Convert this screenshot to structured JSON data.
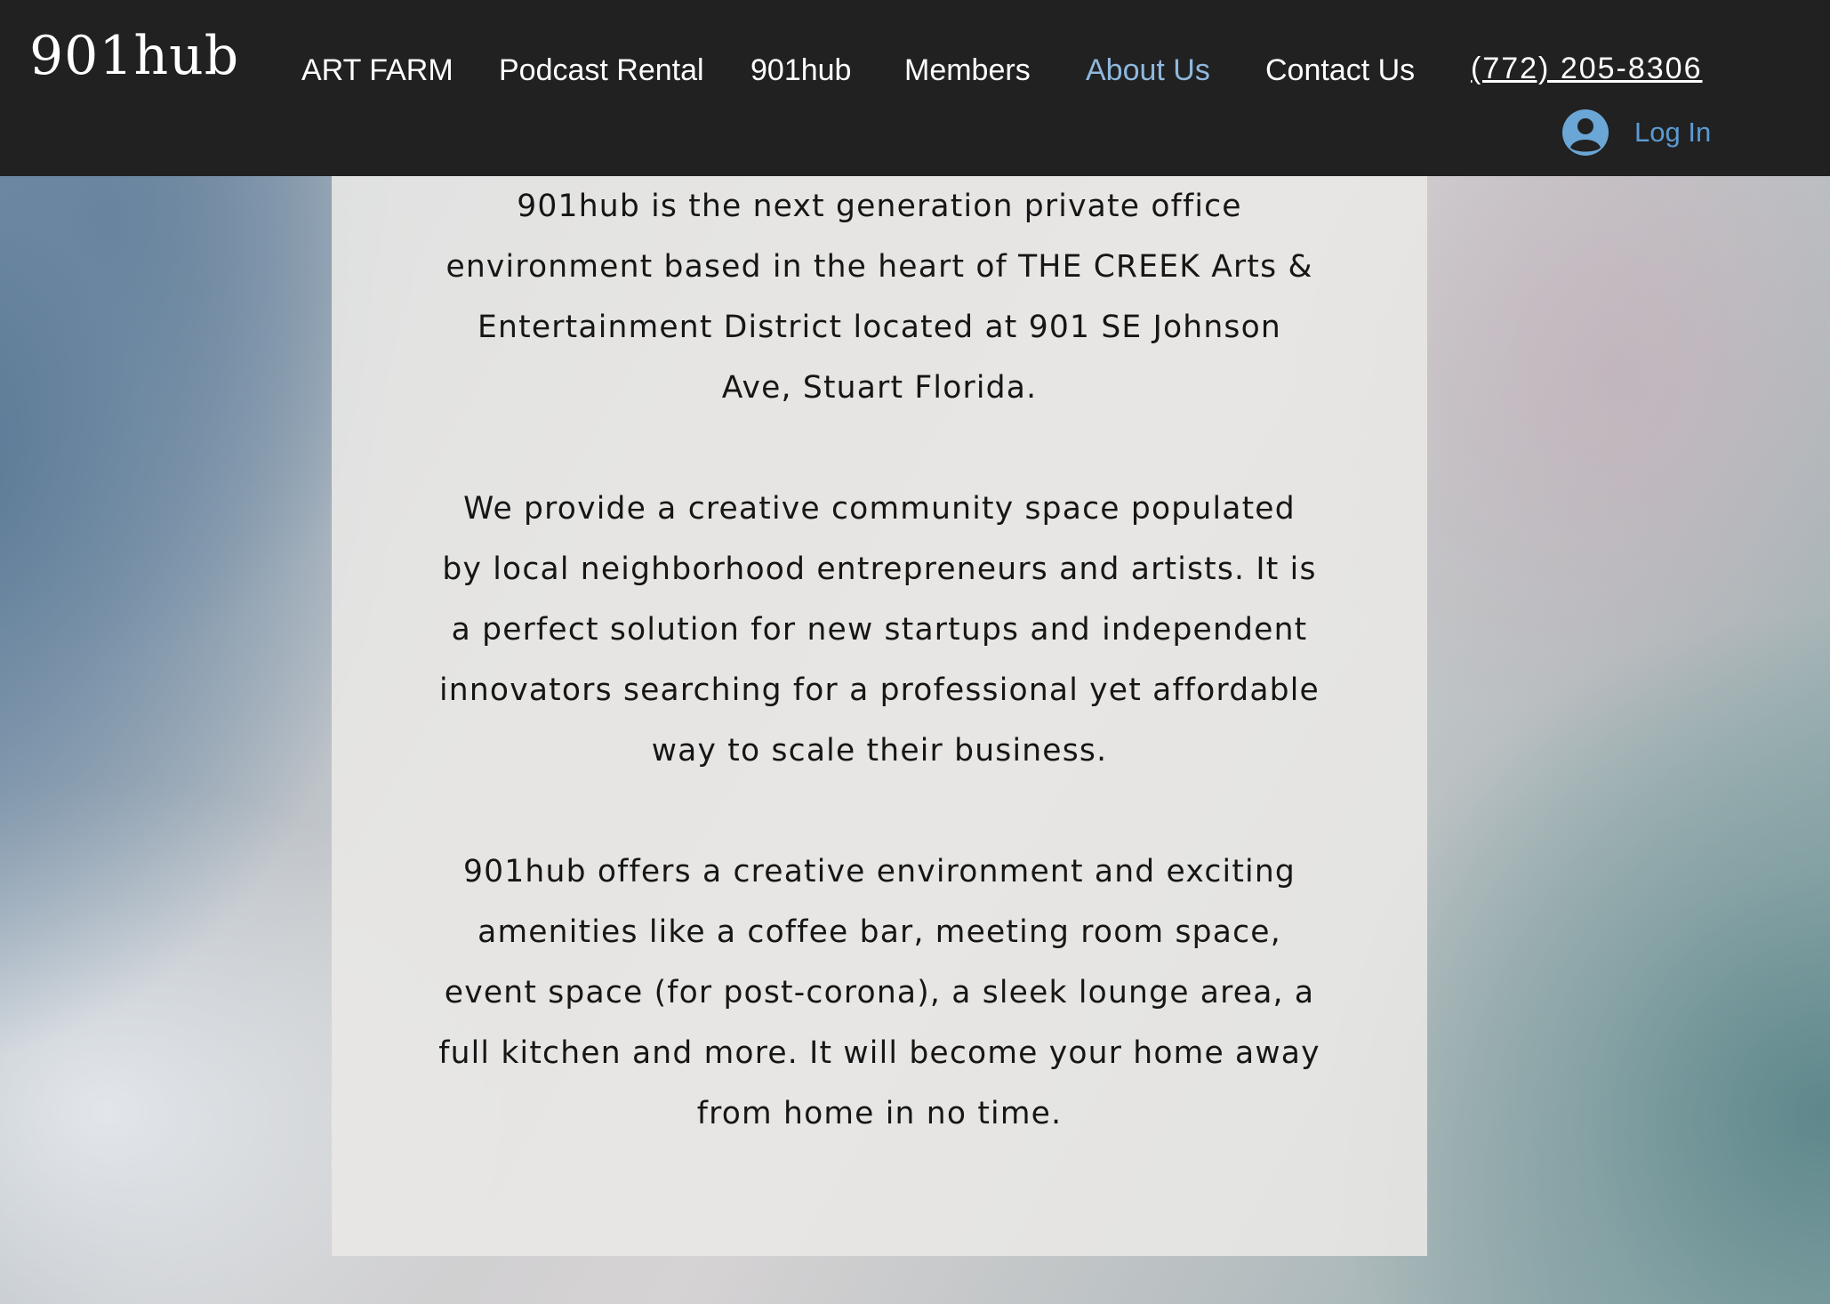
{
  "site": {
    "logo": "901hub"
  },
  "nav": {
    "items": [
      {
        "label": "ART FARM"
      },
      {
        "label": "Podcast Rental"
      },
      {
        "label": "901hub"
      },
      {
        "label": "Members"
      },
      {
        "label": "About Us",
        "active": true
      },
      {
        "label": "Contact Us"
      }
    ],
    "phone": "(772) 205-8306",
    "login_label": "Log In"
  },
  "colors": {
    "topbar": "#212121",
    "nav_text": "#ffffff",
    "nav_active": "#8fb8de",
    "login": "#5b9bd3"
  },
  "about": {
    "paragraphs": [
      "901hub is the next generation private office environment based in the heart of THE CREEK Arts & Entertainment District located at 901 SE Johnson Ave, Stuart Florida.",
      "We provide a creative community space populated by local neighborhood entrepreneurs and artists. It is a perfect solution for new startups and independent innovators searching for a professional yet affordable way to scale their business.",
      "901hub offers a creative environment and exciting amenities like a coffee bar, meeting room space, event space (for post-corona), a sleek lounge area, a full kitchen and more. It will become your home away from home in no time."
    ]
  }
}
